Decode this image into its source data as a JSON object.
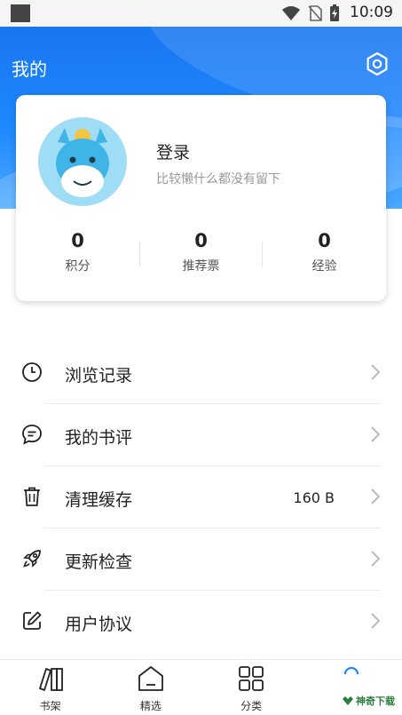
{
  "status_bar": {
    "time": "10:09"
  },
  "header": {
    "title": "我的"
  },
  "profile": {
    "login_label": "登录",
    "subtitle": "比较懒什么都没有留下",
    "stats": [
      {
        "value": "0",
        "label": "积分"
      },
      {
        "value": "0",
        "label": "推荐票"
      },
      {
        "value": "0",
        "label": "经验"
      }
    ]
  },
  "menu": [
    {
      "label": "浏览记录",
      "icon": "clock-icon",
      "value": ""
    },
    {
      "label": "我的书评",
      "icon": "chat-bubble-icon",
      "value": ""
    },
    {
      "label": "清理缓存",
      "icon": "trash-icon",
      "value": "160 B"
    },
    {
      "label": "更新检查",
      "icon": "rocket-icon",
      "value": ""
    },
    {
      "label": "用户协议",
      "icon": "edit-icon",
      "value": ""
    }
  ],
  "bottom_nav": [
    {
      "label": "书架",
      "icon": "bookshelf-icon"
    },
    {
      "label": "精选",
      "icon": "home-icon"
    },
    {
      "label": "分类",
      "icon": "grid-icon"
    },
    {
      "label": "",
      "icon": "profile-icon"
    }
  ],
  "watermark": {
    "text": "神奇下载"
  },
  "colors": {
    "accent": "#1e88ff",
    "header_top": "#1976f0",
    "text": "#222222",
    "muted": "#999999"
  }
}
